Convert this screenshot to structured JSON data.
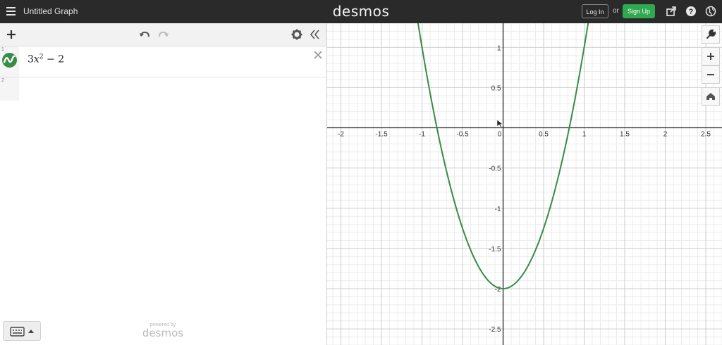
{
  "header": {
    "title": "Untitled Graph",
    "logo": "desmos",
    "login_label": "Log In",
    "or_label": "or",
    "signup_label": "Sign Up",
    "menu_icon": "hamburger-icon",
    "share_icon": "share-icon",
    "help_icon": "help-icon",
    "language_icon": "globe-icon"
  },
  "expression_panel": {
    "toolbar": {
      "add_icon": "plus-icon",
      "undo_icon": "undo-icon",
      "redo_icon": "redo-icon",
      "settings_icon": "gear-icon",
      "collapse_icon": "double-chevron-left-icon"
    },
    "expressions": [
      {
        "index": "1",
        "latex_coef": "3",
        "latex_var": "x",
        "latex_exp": "2",
        "latex_rest": " − 2",
        "color": "#388c46"
      },
      {
        "index": "2"
      }
    ],
    "powered_by": "powered by",
    "powered_logo": "desmos"
  },
  "colors": {
    "header_bg": "#2a2a2a",
    "signup_green": "#2fa84f",
    "curve": "#388c46"
  },
  "chart_data": {
    "type": "line",
    "function": "3x^2 - 2",
    "xlim": [
      -2.17,
      2.7
    ],
    "ylim": [
      -2.7,
      1.3
    ],
    "grid": true,
    "x_ticks": [
      "-2",
      "-1.5",
      "-1",
      "-0.5",
      "0",
      "0.5",
      "1",
      "1.5",
      "2",
      "2.5"
    ],
    "y_ticks": [
      "1",
      "0.5",
      "-0.5",
      "-1",
      "-1.5",
      "-2",
      "-2.5"
    ],
    "x_tick_values": [
      -2,
      -1.5,
      -1,
      -0.5,
      0,
      0.5,
      1,
      1.5,
      2,
      2.5
    ],
    "y_tick_values": [
      1,
      0.5,
      -0.5,
      -1,
      -1.5,
      -2,
      -2.5
    ],
    "series": [
      {
        "color": "#388c46",
        "x": [
          -1.0,
          -0.9,
          -0.8,
          -0.7,
          -0.6,
          -0.5,
          -0.4,
          -0.3,
          -0.2,
          -0.1,
          0,
          0.1,
          0.2,
          0.3,
          0.4,
          0.5,
          0.6,
          0.7,
          0.8,
          0.9,
          1.0
        ],
        "y": [
          1.0,
          0.43,
          -0.08,
          -0.53,
          -0.92,
          -1.25,
          -1.52,
          -1.73,
          -1.88,
          -1.97,
          -2.0,
          -1.97,
          -1.88,
          -1.73,
          -1.52,
          -1.25,
          -0.92,
          -0.53,
          -0.08,
          0.43,
          1.0
        ]
      }
    ]
  }
}
